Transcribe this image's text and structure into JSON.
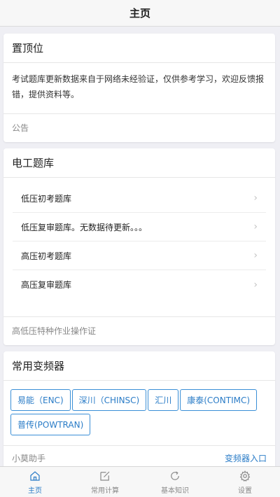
{
  "nav": {
    "title": "主页"
  },
  "notice_card": {
    "title": "置顶位",
    "body": "考试题库更新数据来自于网络未经验证，仅供参考学习，欢迎反馈报错，提供资料等。",
    "footer": "公告"
  },
  "bank_card": {
    "title": "电工题库",
    "items": [
      {
        "label": "低压初考题库"
      },
      {
        "label": "低压复审题库。无数据待更新。。。"
      },
      {
        "label": "高压初考题库"
      },
      {
        "label": "高压复审题库"
      }
    ],
    "footer": "高低压特种作业操作证"
  },
  "inverter_card": {
    "title": "常用变频器",
    "tags": [
      "易能（ENC)",
      "深川（CHINSC)",
      "汇川",
      "康泰(CONTIMC)",
      "普传(POWTRAN)"
    ],
    "footer_left": "小莫助手",
    "footer_link": "变频器入口"
  },
  "tabs": [
    {
      "label": "主页",
      "icon": "home-icon",
      "active": true
    },
    {
      "label": "常用计算",
      "icon": "edit-icon",
      "active": false
    },
    {
      "label": "基本知识",
      "icon": "refresh-icon",
      "active": false
    },
    {
      "label": "设置",
      "icon": "gear-icon",
      "active": false
    }
  ],
  "colors": {
    "accent": "#2a7cc7",
    "inactive": "#8a8a8a",
    "background": "#efeff4"
  },
  "chevron": "›"
}
